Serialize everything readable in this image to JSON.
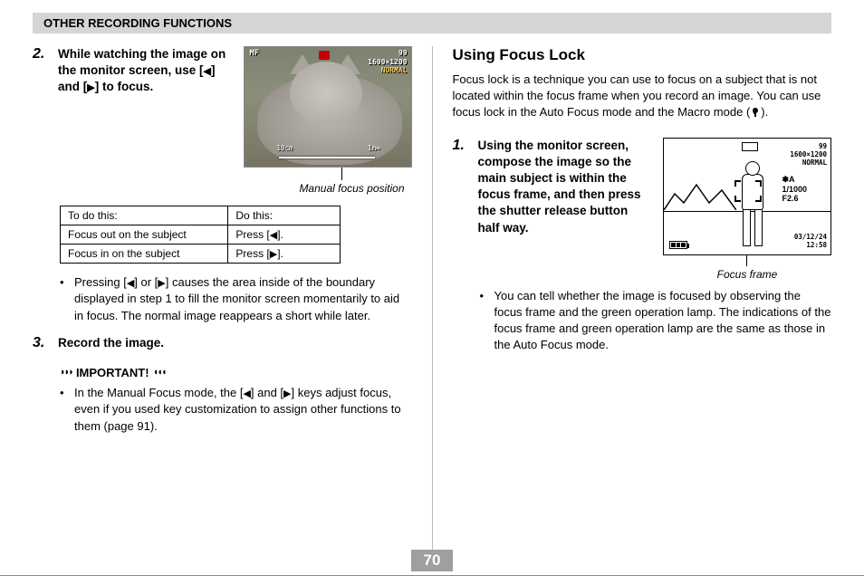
{
  "header": "OTHER RECORDING FUNCTIONS",
  "left": {
    "step2": {
      "num": "2.",
      "text_a": "While watching the image on the monitor screen, use [",
      "text_b": "] and [",
      "text_c": "] to focus."
    },
    "photo": {
      "mf": "MF",
      "count": "99",
      "res": "1600×1200",
      "quality": "NORMAL",
      "scale_left": "10cm",
      "scale_right": "1m∞"
    },
    "caption1": "Manual focus position",
    "table": {
      "h1": "To do this:",
      "h2": "Do this:",
      "r1c1": "Focus out on the subject",
      "r1c2a": "Press [",
      "r1c2b": "].",
      "r2c1": "Focus in on the subject",
      "r2c2a": "Press [",
      "r2c2b": "]."
    },
    "bullet1a": "Pressing [",
    "bullet1b": "] or [",
    "bullet1c": "] causes the area inside of the boundary displayed in step 1 to fill the monitor screen momentarily to aid in focus. The normal image reappears a short while later.",
    "step3": {
      "num": "3.",
      "text": "Record the image."
    },
    "important_label": "IMPORTANT!",
    "important_bullet_a": "In the Manual Focus mode, the [",
    "important_bullet_b": "] and [",
    "important_bullet_c": "] keys adjust focus, even if you used key customization to assign other functions to them (page 91)."
  },
  "right": {
    "heading": "Using Focus Lock",
    "intro_a": "Focus lock is a technique you can use to focus on a subject that is not located within the focus frame when you record an image. You can use focus lock in the Auto Focus mode and the Macro mode (",
    "intro_b": ").",
    "step1": {
      "num": "1.",
      "text": "Using the monitor screen, compose the image so the main subject is within the focus frame, and then press the shutter release button half way."
    },
    "diagram": {
      "count": "99",
      "res": "1600×1200",
      "quality": "NORMAL",
      "flash": "✽A",
      "shutter": "1/1000",
      "fstop": "F2.6",
      "date": "03/12/24",
      "time": "12:58"
    },
    "diag_caption": "Focus frame",
    "bullet": "You can tell whether the image is focused by observing the focus frame and the green operation lamp. The indications of the focus frame and green operation lamp are the same as those in the Auto Focus mode."
  },
  "page_number": "70"
}
